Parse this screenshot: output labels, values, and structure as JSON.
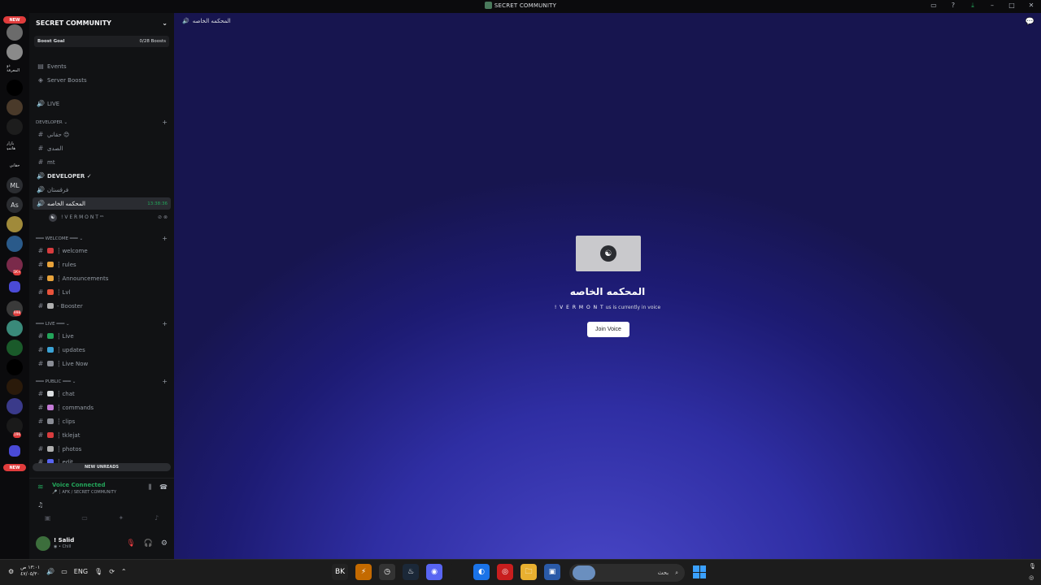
{
  "titlebar": {
    "server_name": "SECRET COMMUNITY"
  },
  "rail": {
    "new_badge_top": "NEW",
    "new_badge_bottom": "NEW",
    "labels": [
      "ذو المعرفة",
      "بازار هاتمو",
      "حقاني",
      "ML",
      "As"
    ],
    "ping_counts": [
      "5K+",
      "998",
      "196"
    ]
  },
  "sidebar": {
    "guild_name": "SECRET COMMUNITY",
    "boost_goal": {
      "label": "Boost Goal",
      "progress": "0/28 Boosts"
    },
    "items": [
      {
        "kind": "nav",
        "icon": "▤",
        "label": "Events"
      },
      {
        "kind": "nav",
        "icon": "◈",
        "label": "Server Boosts"
      },
      {
        "kind": "voice",
        "label": "LIVE"
      },
      {
        "kind": "category",
        "label": "DEVELOPER ⌄"
      },
      {
        "kind": "text",
        "label": "حقاني 😊"
      },
      {
        "kind": "text",
        "label": "الصدى"
      },
      {
        "kind": "text",
        "label": "mt"
      },
      {
        "kind": "voice-bold",
        "label": "DEVELOPER ✓"
      },
      {
        "kind": "voice",
        "label": "فرقستان"
      },
      {
        "kind": "voice-active",
        "label": "المحكمه الخاصه",
        "timer": "13:38:36"
      },
      {
        "kind": "user",
        "label": "! V E R M O N T ᵘˢ"
      },
      {
        "kind": "category",
        "label": "━━━ welcome ━━━ ⌄"
      },
      {
        "kind": "text-emoji",
        "emoji_color": "#d83c3e",
        "label": "┆ welcome"
      },
      {
        "kind": "text-emoji",
        "emoji_color": "#e8a33b",
        "label": "┆ rules"
      },
      {
        "kind": "text-emoji",
        "emoji_color": "#e8a33b",
        "label": "┆ Announcements"
      },
      {
        "kind": "text-emoji",
        "emoji_color": "#e8533b",
        "label": "┆ Lvl"
      },
      {
        "kind": "text-emoji",
        "emoji_color": "#b0b0b0",
        "label": "- Booster"
      },
      {
        "kind": "category",
        "label": "━━━ LIVE ━━━ ⌄"
      },
      {
        "kind": "text-emoji",
        "emoji_color": "#23a55a",
        "label": "┆ Live"
      },
      {
        "kind": "text-emoji",
        "emoji_color": "#3ba3d6",
        "label": "┆ updates"
      },
      {
        "kind": "text-emoji",
        "emoji_color": "#8a8d95",
        "label": "┆ Live Now"
      },
      {
        "kind": "category",
        "label": "━━━ PUBLIC ━━━ ⌄"
      },
      {
        "kind": "text-emoji",
        "emoji_color": "#dbdee1",
        "label": "┆ chat"
      },
      {
        "kind": "text-emoji",
        "emoji_color": "#c47ad6",
        "label": "┆ commands"
      },
      {
        "kind": "text-emoji",
        "emoji_color": "#8a8d95",
        "label": "┆ clips"
      },
      {
        "kind": "text-emoji",
        "emoji_color": "#d83c3e",
        "label": "┆ tklejat"
      },
      {
        "kind": "text-emoji",
        "emoji_color": "#b0b0b0",
        "label": "┆ photos"
      },
      {
        "kind": "text-emoji",
        "emoji_color": "#5865f2",
        "label": "┆ edit"
      }
    ],
    "new_unreads": "NEW UNREADS",
    "voice": {
      "status": "Voice Connected",
      "location": "🎤 ┆ AFK / SECRET COMMUNITY"
    },
    "user": {
      "name": "! Salid",
      "status": "◉ • Chill"
    }
  },
  "main": {
    "channel_name": "المحكمه الخاصه",
    "voice_title": "المحكمه الخاصه",
    "in_voice_user": "! V E R M O N T",
    "in_voice_suffix": " us is currently in voice",
    "join_label": "Join Voice"
  },
  "taskbar": {
    "clock_time": "١٣:٠١ ص",
    "clock_date": "٤٧/٠٥/٣٠",
    "lang": "ENG",
    "search_placeholder": "بحث",
    "apps": [
      "BK",
      "⚡",
      "◷",
      "♨",
      "◉",
      "◐",
      "◎",
      "🗀",
      "▣"
    ]
  },
  "colors": {
    "accent_green": "#23a55a",
    "badge_red": "#e03c3c",
    "main_bg_center": "#4a48c9",
    "main_bg_edge": "#17154f"
  }
}
